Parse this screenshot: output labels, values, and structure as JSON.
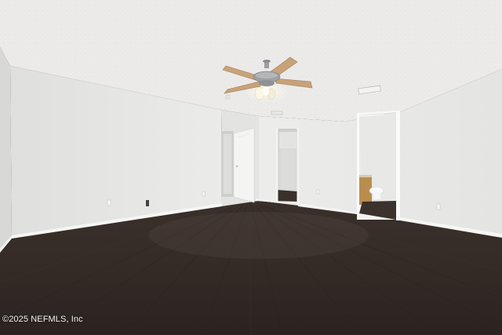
{
  "photo": {
    "subject": "empty room",
    "watermark": "©2025 NEFMLS, Inc"
  },
  "colors": {
    "ceiling": "#ecebea",
    "wall_left": "#e6e6e4",
    "wall_back": "#efefed",
    "wall_right": "#eaeae8",
    "floor_dark": "#2e2622",
    "floor_mid": "#3c3430",
    "baseboard": "#f6f6f4",
    "fan_blade": "#c8a278",
    "fan_metal": "#9c9ea2"
  }
}
